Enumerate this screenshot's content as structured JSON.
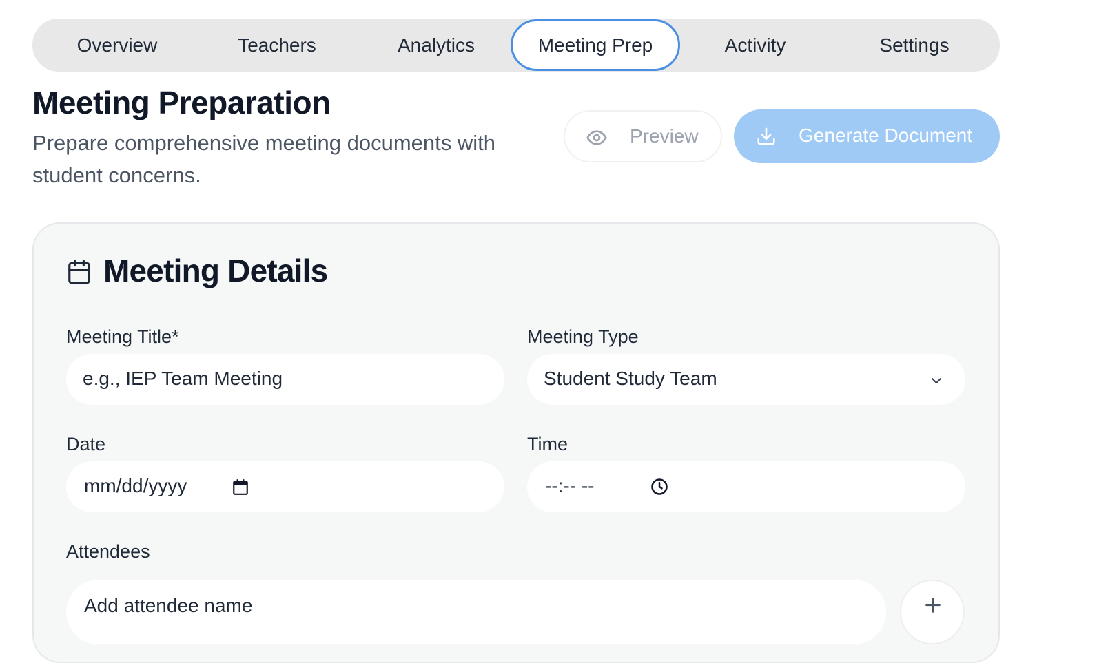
{
  "tabs": {
    "overview": "Overview",
    "teachers": "Teachers",
    "analytics": "Analytics",
    "meeting_prep": "Meeting Prep",
    "activity": "Activity",
    "settings": "Settings",
    "active": "Meeting Prep"
  },
  "header": {
    "title": "Meeting Preparation",
    "subtitle": "Prepare comprehensive meeting documents with student concerns."
  },
  "actions": {
    "preview_label": "Preview",
    "preview_icon": "eye-icon",
    "generate_label": "Generate Document",
    "generate_icon": "download-icon",
    "generate_color": "#9fcaf5"
  },
  "meeting_details": {
    "title": "Meeting Details",
    "icon": "calendar-icon",
    "meeting_title_label": "Meeting Title*",
    "meeting_title_placeholder": "e.g., IEP Team Meeting",
    "meeting_type_label": "Meeting Type",
    "meeting_type_value": "Student Study Team",
    "date_label": "Date",
    "date_placeholder": "mm/dd/yyyy",
    "time_label": "Time",
    "time_placeholder": "--:-- --",
    "attendees_label": "Attendees",
    "attendee_placeholder": "Add attendee name"
  },
  "colors": {
    "accent": "#4a90e2",
    "tab_bg": "#e8e8e8",
    "card_bg": "#f6f7f7"
  }
}
